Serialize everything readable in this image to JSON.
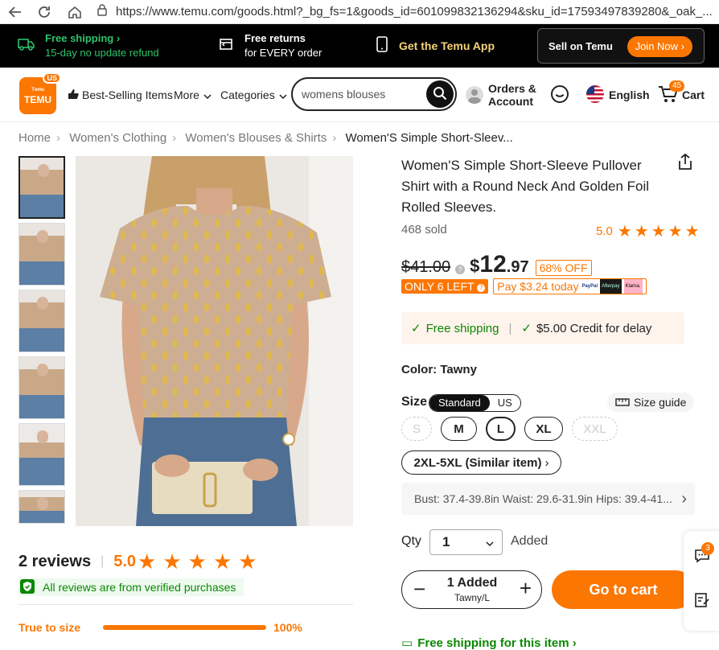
{
  "browser": {
    "url": "https://www.temu.com/goods.html?_bg_fs=1&goods_id=601099832136294&sku_id=17593497839280&_oak_..."
  },
  "topbar": {
    "shipping_title": "Free shipping",
    "shipping_sub": "15-day no update refund",
    "returns_title": "Free returns",
    "returns_sub": "for EVERY order",
    "app": "Get the Temu App",
    "sell": "Sell on Temu",
    "join": "Join Now"
  },
  "header": {
    "logo_top": "ᵀᵉᵐᵘ",
    "logo_text": "TEMU",
    "logo_badge": "US",
    "best_selling": "Best-Selling Items",
    "more": "More",
    "categories": "Categories",
    "search_value": "womens blouses",
    "orders_l1": "Orders &",
    "orders_l2": "Account",
    "language": "English",
    "cart": "Cart",
    "cart_count": "45"
  },
  "breadcrumb": {
    "items": [
      "Home",
      "Women's Clothing",
      "Women's Blouses & Shirts"
    ],
    "current": "Women'S Simple Short-Sleev..."
  },
  "product": {
    "title": "Women'S Simple Short-Sleeve Pullover Shirt with a Round Neck And Golden Foil Rolled Sleeves.",
    "sold": "468 sold",
    "rating": "5.0",
    "original_price": "$41.00",
    "price_dollar": "$",
    "price_main": "12",
    "price_cents": ".97",
    "discount": "68% OFF",
    "stock": "ONLY 6 LEFT",
    "pay_today": "Pay $3.24 today",
    "pay_logos": [
      "PayPal",
      "Afterpay",
      "Klarna."
    ],
    "free_shipping": "Free shipping",
    "credit": "$5.00 Credit for delay",
    "color_label": "Color:",
    "color_value": "Tawny",
    "size_label": "Size",
    "size_tabs": [
      "Standard",
      "US"
    ],
    "size_guide": "Size guide",
    "sizes": [
      "S",
      "M",
      "L",
      "XL",
      "XXL"
    ],
    "plus_size": "2XL-5XL (Similar item)",
    "measurements": "Bust: 37.4-39.8in Waist: 29.6-31.9in Hips: 39.4-41...",
    "qty_label": "Qty",
    "qty_value": "1",
    "added": "Added",
    "stepper_count": "1 Added",
    "stepper_variant": "Tawny/L",
    "go_to_cart": "Go to cart",
    "free_ship_item": "Free shipping for this item"
  },
  "reviews": {
    "title": "2 reviews",
    "rating": "5.0",
    "verified": "All reviews are from verified purchases",
    "fit_label": "True to size",
    "fit_percent": "100%",
    "fit_value": 100
  },
  "side": {
    "badge": "3"
  },
  "colors": {
    "accent": "#fb7701",
    "green": "#0a8800",
    "topbar": "#000000"
  }
}
